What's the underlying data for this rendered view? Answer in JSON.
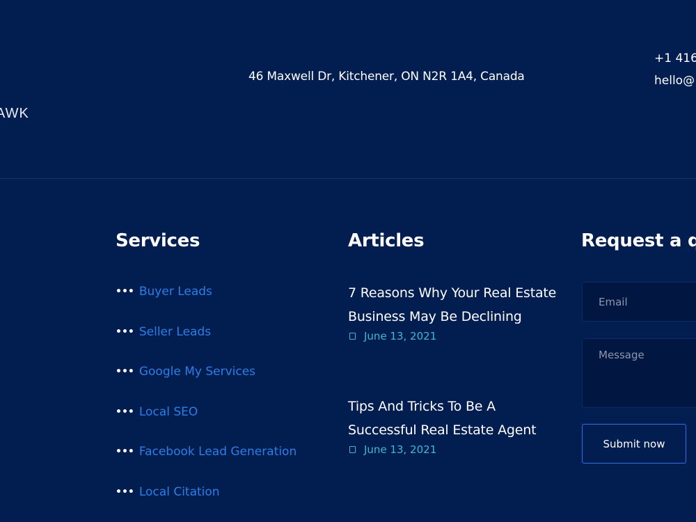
{
  "header": {
    "logo_text": "AWK",
    "address": "46 Maxwell Dr, Kitchener, ON N2R 1A4, Canada",
    "phone": "+1 416",
    "email": "hello@"
  },
  "services": {
    "title": "Services",
    "bullet": "•••",
    "items": [
      {
        "label": "Buyer Leads"
      },
      {
        "label": "Seller Leads"
      },
      {
        "label": "Google My Services"
      },
      {
        "label": "Local SEO"
      },
      {
        "label": "Facebook Lead Generation"
      },
      {
        "label": "Local Citation"
      }
    ]
  },
  "articles": {
    "title": "Articles",
    "items": [
      {
        "title": "7 Reasons Why Your Real Estate Business May Be Declining",
        "date": "June 13, 2021"
      },
      {
        "title": "Tips And Tricks To Be A Successful Real Estate Agent",
        "date": "June 13, 2021"
      }
    ]
  },
  "quote": {
    "title": "Request a qu",
    "email_placeholder": "Email",
    "message_placeholder": "Message",
    "submit_label": "Submit now"
  },
  "colors": {
    "background": "#021d4f",
    "link": "#2b7fe6",
    "date": "#3fb8d6",
    "button_border": "#2f6ee8"
  },
  "icons": {
    "article_date": "calendar-icon"
  }
}
